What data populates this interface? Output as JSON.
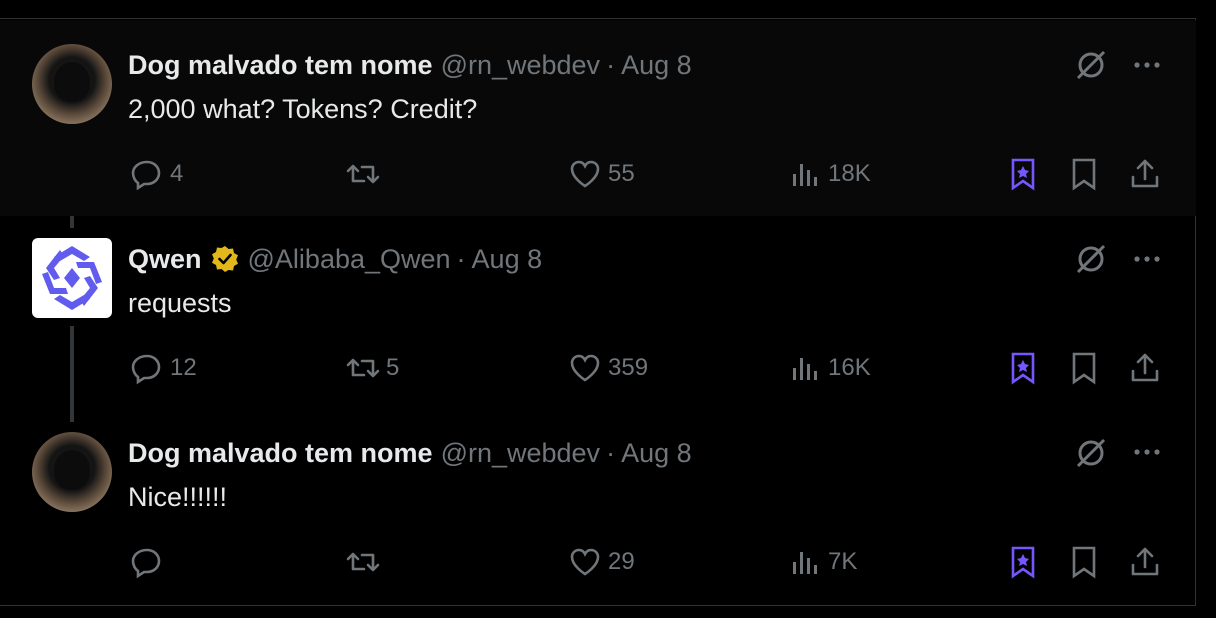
{
  "tweets": [
    {
      "name": "Dog malvado tem nome",
      "handle": "@rn_webdev",
      "separator": "·",
      "date": "Aug 8",
      "text": "2,000 what? Tokens? Credit?",
      "replies": "4",
      "retweets": "",
      "likes": "55",
      "views": "18K",
      "avatar": "dog-avatar",
      "verified": false
    },
    {
      "name": "Qwen",
      "handle": "@Alibaba_Qwen",
      "separator": "·",
      "date": "Aug 8",
      "text": "requests",
      "replies": "12",
      "retweets": "5",
      "likes": "359",
      "views": "16K",
      "avatar": "qwen-logo",
      "verified": true
    },
    {
      "name": "Dog malvado tem nome",
      "handle": "@rn_webdev",
      "separator": "·",
      "date": "Aug 8",
      "text": "Nice!!!!!!",
      "replies": "",
      "retweets": "",
      "likes": "29",
      "views": "7K",
      "avatar": "dog-avatar",
      "verified": false
    }
  ],
  "colors": {
    "background": "#000000",
    "text": "#e7e9ea",
    "muted": "#71767b",
    "grok_purple": "#7856ff",
    "verified_gold": "#e2b719",
    "qwen_brand": "#615ced"
  },
  "icons": [
    "reply-icon",
    "retweet-icon",
    "like-icon",
    "views-icon",
    "grok-bookmark-icon",
    "bookmark-icon",
    "share-icon",
    "grok-icon",
    "more-icon",
    "verified-badge-icon"
  ]
}
